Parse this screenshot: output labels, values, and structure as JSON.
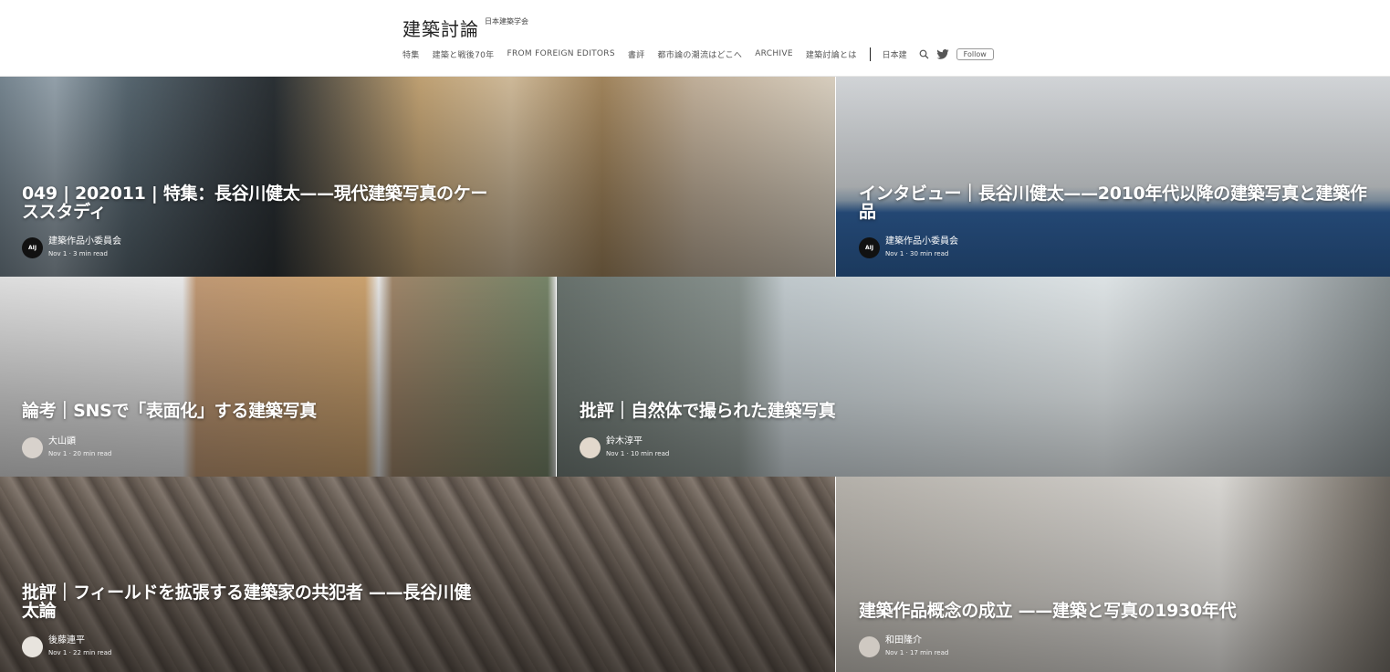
{
  "header": {
    "title": "建築討論",
    "subtitle": "日本建築学会",
    "nav": [
      "特集",
      "建築と戦後70年",
      "FROM FOREIGN EDITORS",
      "書評",
      "都市論の潮流はどこへ",
      "ARCHIVE",
      "建築討論とは"
    ],
    "lang": "日本建",
    "follow_label": "Follow",
    "icons": [
      "search-icon",
      "twitter-icon"
    ]
  },
  "articles": [
    {
      "title": "049 | 202011 | 特集：長谷川健太——現代建築写真のケーススタディ",
      "author": "建築作品小委員会",
      "meta": "Nov 1 · 3 min read",
      "avatar_text": "AIJ"
    },
    {
      "title": "インタビュー｜長谷川健太——2010年代以降の建築写真と建築作品",
      "author": "建築作品小委員会",
      "meta": "Nov 1 · 30 min read",
      "avatar_text": "AIJ"
    },
    {
      "title": "論考｜SNSで「表面化」する建築写真",
      "author": "大山顕",
      "meta": "Nov 1 · 20 min read",
      "avatar_text": ""
    },
    {
      "title": "批評｜自然体で撮られた建築写真",
      "author": "鈴木淳平",
      "meta": "Nov 1 · 10 min read",
      "avatar_text": ""
    },
    {
      "title": "批評｜フィールドを拡張する建築家の共犯者 ——長谷川健太論",
      "author": "後藤連平",
      "meta": "Nov 1 · 22 min read",
      "avatar_text": ""
    },
    {
      "title": "建築作品概念の成立 ——建築と写真の1930年代",
      "author": "和田隆介",
      "meta": "Nov 1 · 17 min read",
      "avatar_text": ""
    }
  ],
  "colors": {
    "header_bg": "#ffffff",
    "text_on_image": "#ffffff",
    "nav_text": "#555555"
  }
}
